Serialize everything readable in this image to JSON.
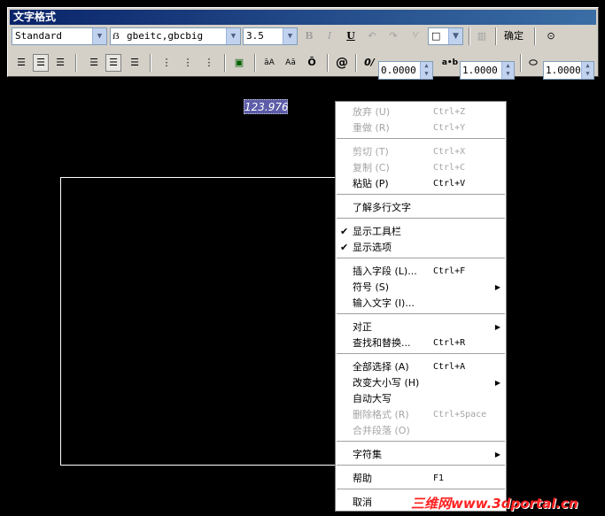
{
  "toolbar": {
    "title": "文字格式",
    "style_value": "Standard",
    "font_value": "gbeitc,gbcbig",
    "height_value": "3.5",
    "bold": "B",
    "italic": "I",
    "underline": "U",
    "color_value": "□",
    "ok_label": "确定",
    "oblique_value": "0.0000",
    "tracking_value": "1.0000",
    "width_value": "1.0000",
    "oblique_icon": "0/",
    "tracking_icon": "a•b",
    "at_icon": "@"
  },
  "canvas": {
    "selected_text": "123.976"
  },
  "menu": {
    "items": [
      {
        "label": "放弃 (U)",
        "shortcut": "Ctrl+Z",
        "disabled": true
      },
      {
        "label": "重做 (R)",
        "shortcut": "Ctrl+Y",
        "disabled": true
      },
      {
        "label": "剪切 (T)",
        "shortcut": "Ctrl+X",
        "disabled": true
      },
      {
        "label": "复制 (C)",
        "shortcut": "Ctrl+C",
        "disabled": true
      },
      {
        "label": "粘贴 (P)",
        "shortcut": "Ctrl+V",
        "disabled": false
      },
      {
        "label": "了解多行文字",
        "shortcut": "",
        "disabled": false
      },
      {
        "label": "显示工具栏",
        "shortcut": "",
        "checked": true
      },
      {
        "label": "显示选项",
        "shortcut": "",
        "checked": true
      },
      {
        "label": "插入字段 (L)...",
        "shortcut": "Ctrl+F",
        "disabled": false
      },
      {
        "label": "符号 (S)",
        "shortcut": "",
        "submenu": true
      },
      {
        "label": "输入文字 (I)...",
        "shortcut": "",
        "disabled": false
      },
      {
        "label": "对正",
        "shortcut": "",
        "submenu": true
      },
      {
        "label": "查找和替换...",
        "shortcut": "Ctrl+R",
        "disabled": false
      },
      {
        "label": "全部选择 (A)",
        "shortcut": "Ctrl+A",
        "disabled": false
      },
      {
        "label": "改变大小写 (H)",
        "shortcut": "",
        "submenu": true
      },
      {
        "label": "自动大写",
        "shortcut": "",
        "disabled": false
      },
      {
        "label": "删除格式 (R)",
        "shortcut": "Ctrl+Space",
        "disabled": true
      },
      {
        "label": "合并段落 (O)",
        "shortcut": "",
        "disabled": true
      },
      {
        "label": "字符集",
        "shortcut": "",
        "submenu": true
      },
      {
        "label": "帮助",
        "shortcut": "F1",
        "disabled": false
      },
      {
        "label": "取消",
        "shortcut": "",
        "disabled": false
      }
    ]
  },
  "watermark": "三维网www.3dportal.cn"
}
